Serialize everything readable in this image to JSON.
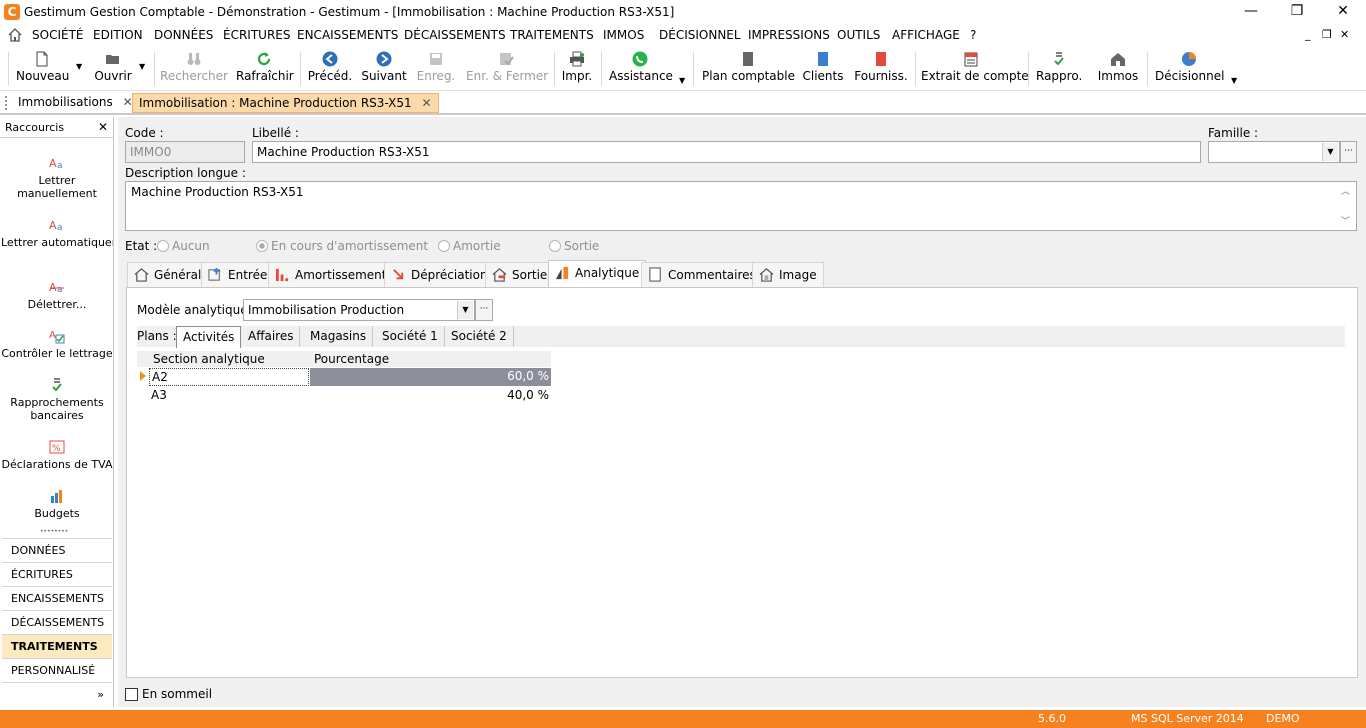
{
  "window": {
    "title": "Gestimum Gestion Comptable - Démonstration - Gestimum - [Immobilisation : Machine Production RS3-X51]",
    "logo_letter": "C",
    "minimize": "—",
    "maximize": "❐",
    "close": "✕",
    "menu_minimize": "_",
    "menu_restore": "❐",
    "menu_close": "✕",
    "accent": "#f5821f"
  },
  "menubar": {
    "items": [
      "SOCIÉTÉ",
      "EDITION",
      "DONNÉES",
      "ÉCRITURES",
      "ENCAISSEMENTS",
      "DÉCAISSEMENTS",
      "TRAITEMENTS",
      "IMMOS",
      "DÉCISIONNEL",
      "IMPRESSIONS",
      "OUTILS",
      "AFFICHAGE",
      "?"
    ]
  },
  "toolbar": {
    "nouveau": "Nouveau",
    "ouvrir": "Ouvrir",
    "rechercher": "Rechercher",
    "rafraichir": "Rafraîchir",
    "preced": "Précéd.",
    "suivant": "Suivant",
    "enreg": "Enreg.",
    "enreg_fermer": "Enr. & Fermer",
    "impr": "Impr.",
    "assistance": "Assistance",
    "plan_comptable": "Plan comptable",
    "clients": "Clients",
    "fourniss": "Fourniss.",
    "extrait": "Extrait de compte",
    "rappro": "Rappro.",
    "immos": "Immos",
    "decisionnel": "Décisionnel"
  },
  "doc_tabs": [
    {
      "label": "Immobilisations",
      "close": "✕"
    },
    {
      "label": "Immobilisation : Machine Production RS3-X51",
      "close": "✕",
      "active": true
    }
  ],
  "sidebar": {
    "title": "Raccourcis",
    "close": "✕",
    "shortcuts": [
      "Lettrer manuellement",
      "Lettrer automatiquement...",
      "Délettrer...",
      "Contrôler le lettrage",
      "Rapprochements bancaires",
      "Déclarations de TVA",
      "Budgets"
    ],
    "more": "••••••••",
    "nav": [
      "DONNÉES",
      "ÉCRITURES",
      "ENCAISSEMENTS",
      "DÉCAISSEMENTS",
      "TRAITEMENTS",
      "PERSONNALISÉ"
    ],
    "nav_active": "TRAITEMENTS",
    "expand": "»"
  },
  "form": {
    "code_label": "Code :",
    "code_value": "IMMO0",
    "libelle_label": "Libellé :",
    "libelle_value": "Machine Production RS3-X51",
    "famille_label": "Famille :",
    "famille_value": "",
    "desc_label": "Description longue :",
    "desc_value": "Machine Production RS3-X51",
    "etat_label": "Etat :",
    "etat_options": [
      "Aucun",
      "En cours d'amortissement",
      "Amortie",
      "Sortie"
    ],
    "etat_selected": "En cours d'amortissement"
  },
  "page_tabs": [
    "Général",
    "Entrée",
    "Amortissement",
    "Dépréciation",
    "Sortie",
    "Analytique",
    "Commentaires",
    "Image"
  ],
  "page_tab_active": "Analytique",
  "analytique": {
    "modele_label": "Modèle analytique",
    "modele_value": "Immobilisation Production",
    "plans_label": "Plans :",
    "plans": [
      "Activités",
      "Affaires",
      "Magasins",
      "Société 1",
      "Société 2"
    ],
    "plan_active": "Activités",
    "columns": [
      "Section analytique",
      "Pourcentage"
    ],
    "rows": [
      {
        "section": "A2",
        "pct": "60,0 %"
      },
      {
        "section": "A3",
        "pct": "40,0 %"
      }
    ]
  },
  "en_sommeil": "En sommeil",
  "status": {
    "version": "5.6.0",
    "db": "MS SQL Server 2014",
    "mode": "DEMO"
  }
}
